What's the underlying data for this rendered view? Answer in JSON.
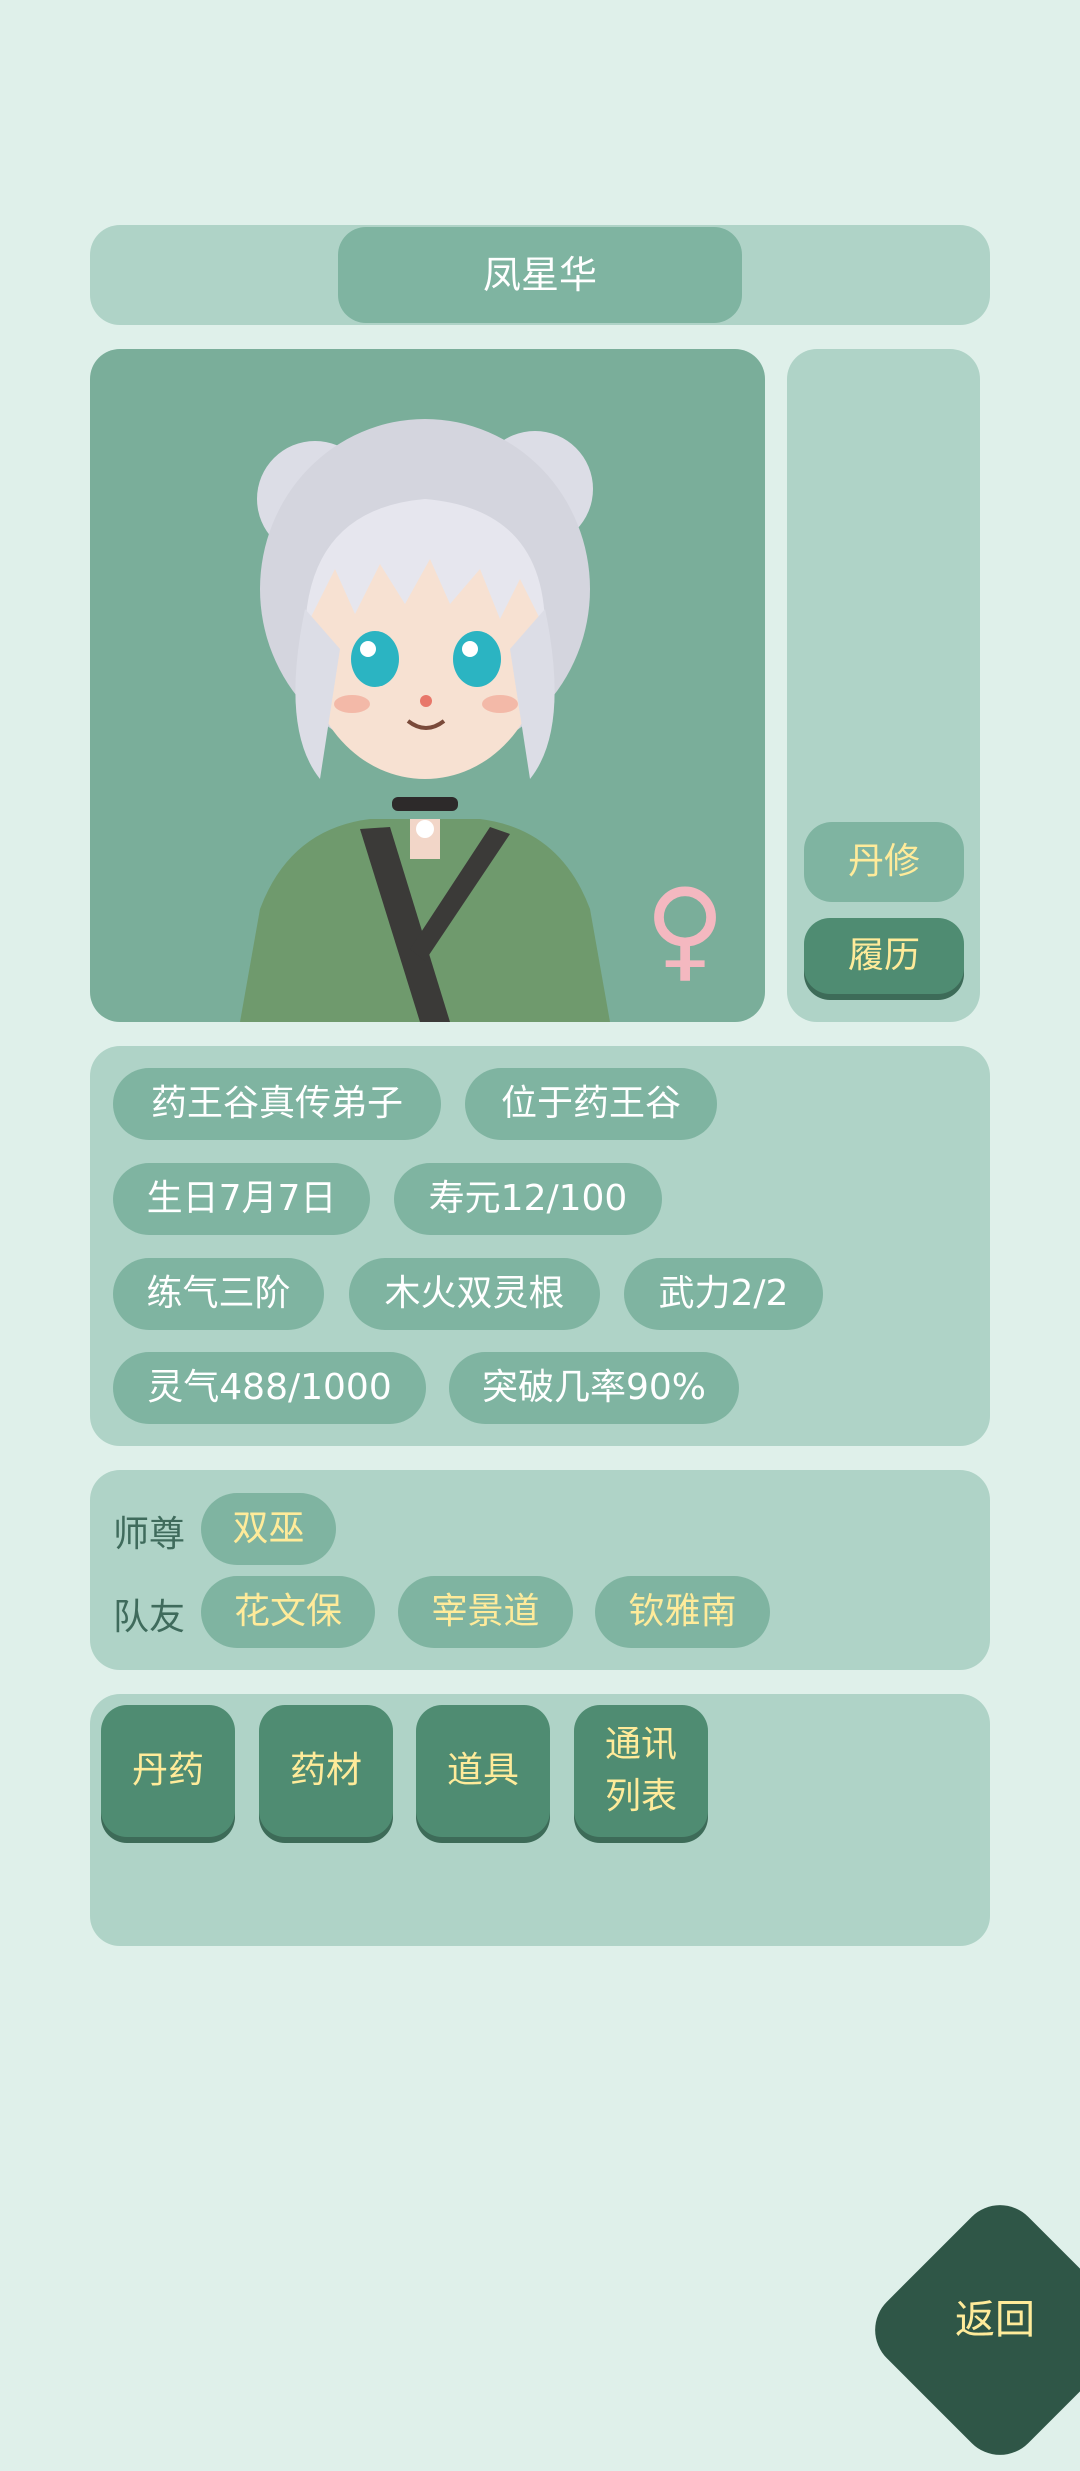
{
  "colors": {
    "background": "#dff0ea",
    "panel": "#afd3c7",
    "chip": "#7fb4a1",
    "button": "#4f8c72",
    "gold_text": "#ffeb9a",
    "female_symbol": "#f4b8c0",
    "back_button": "#2f5647"
  },
  "header": {
    "name": "凤星华"
  },
  "portrait": {
    "gender_symbol": "♀"
  },
  "side_buttons": {
    "dan_label": "丹修",
    "history_label": "履历"
  },
  "info_tags": [
    "药王谷真传弟子",
    "位于药王谷",
    "生日7月7日",
    "寿元12/100",
    "练气三阶",
    "木火双灵根",
    "武力2/2",
    "灵气488/1000",
    "突破几率90%"
  ],
  "relations": {
    "master_label": "师尊",
    "master": "双巫",
    "team_label": "队友",
    "teammates": [
      "花文保",
      "宰景道",
      "钦雅南"
    ]
  },
  "actions": {
    "pills": "丹药",
    "herbs": "药材",
    "items": "道具",
    "contacts_line1": "通讯",
    "contacts_line2": "列表"
  },
  "back_label": "返回"
}
